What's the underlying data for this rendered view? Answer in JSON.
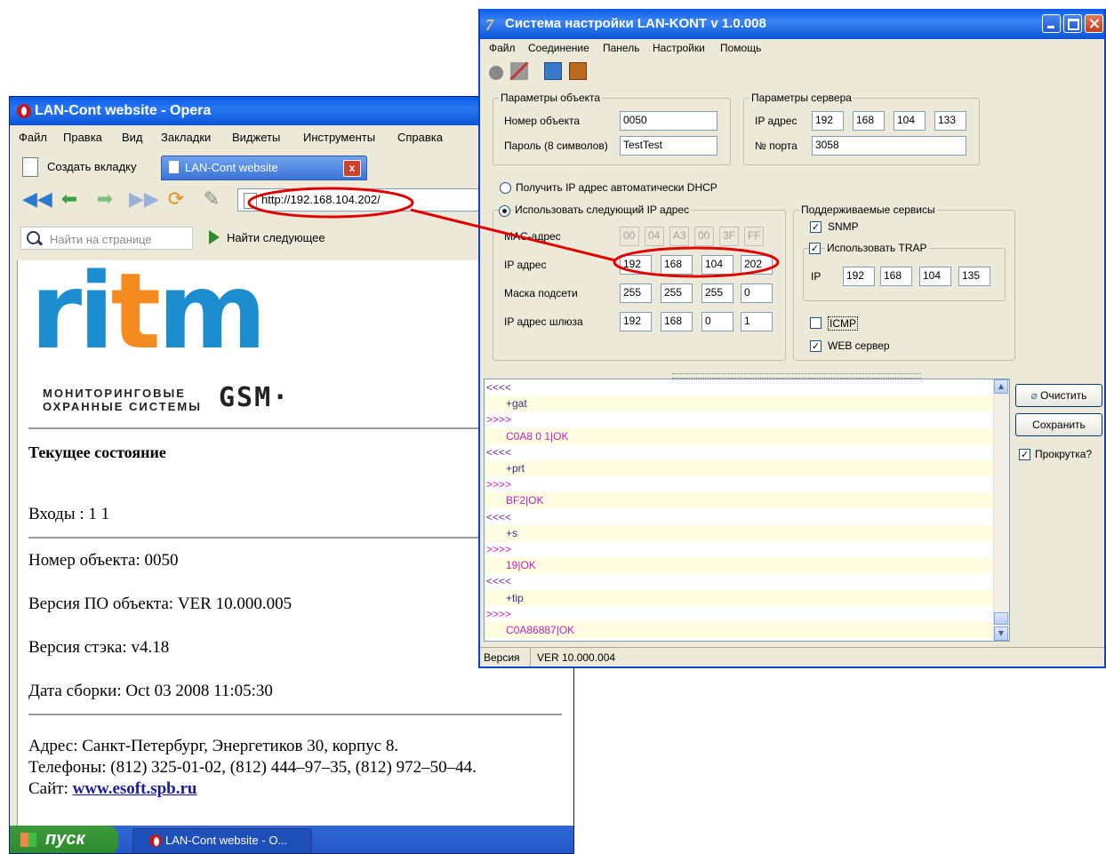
{
  "opera": {
    "title": "LAN-Cont website - Opera",
    "menu": [
      "Файл",
      "Правка",
      "Вид",
      "Закладки",
      "Виджеты",
      "Инструменты",
      "Справка"
    ],
    "new_tab_label": "Создать вкладку",
    "active_tab": "LAN-Cont website",
    "address": "http://192.168.104.202/",
    "find_placeholder": "Найти на странице",
    "find_next": "Найти следующее",
    "logo": {
      "brand_part1": "ri",
      "brand_part2": "t",
      "brand_part3": "m",
      "subtitle_line1": "МОНИТОРИНГОВЫЕ",
      "subtitle_line2": "ОХРАННЫЕ СИСТЕМЫ",
      "gsm": "GSM·"
    },
    "page": {
      "heading": "Текущее состояние",
      "inputs": "Входы : 1 1",
      "object_number": "Номер объекта: 0050",
      "firmware": "Версия ПО объекта: VER 10.000.005",
      "stack": "Версия стэка: v4.18",
      "build_date": "Дата сборки: Oct 03 2008 11:05:30",
      "address": "Адрес: Санкт-Петербург, Энергетиков 30, корпус 8.",
      "phones": "Телефоны: (812) 325-01-02, (812) 444–97–35, (812) 972–50–44.",
      "site_label": "Сайт:",
      "site_link": "www.esoft.spb.ru"
    },
    "taskbar": {
      "start": "пуск",
      "item": "LAN-Cont website - O..."
    }
  },
  "lan": {
    "title": "Система настройки LAN-KONT v 1.0.008",
    "menu": [
      "Файл",
      "Соединение",
      "Панель",
      "Настройки",
      "Помощь"
    ],
    "object_params": {
      "title": "Параметры объекта",
      "number_label": "Номер объекта",
      "number_value": "0050",
      "password_label": "Пароль (8 символов)",
      "password_value": "TestTest"
    },
    "server_params": {
      "title": "Параметры сервера",
      "ip_label": "IP адрес",
      "ip": [
        "192",
        "168",
        "104",
        "133"
      ],
      "port_label": "№ порта",
      "port_value": "3058"
    },
    "dhcp_radio": "Получить IP адрес автоматически DHCP",
    "static": {
      "title": "Использовать следующий IP адрес",
      "mac_label": "MAC-адрес",
      "mac": [
        "00",
        "04",
        "A3",
        "00",
        "3F",
        "FF"
      ],
      "ip_label": "IP адрес",
      "ip": [
        "192",
        "168",
        "104",
        "202"
      ],
      "mask_label": "Маска подсети",
      "mask": [
        "255",
        "255",
        "255",
        "0"
      ],
      "gateway_label": "IP адрес шлюза",
      "gateway": [
        "192",
        "168",
        "0",
        "1"
      ]
    },
    "services": {
      "title": "Поддерживаемые сервисы",
      "snmp": "SNMP",
      "trap": "Использовать TRAP",
      "trap_ip_label": "IP",
      "trap_ip": [
        "192",
        "168",
        "104",
        "135"
      ],
      "icmp": "ICMP",
      "web": "WEB сервер",
      "check_mark": "✓"
    },
    "log": [
      {
        "text": "<<<<",
        "color": "#6a2aa0"
      },
      {
        "text": "+gat",
        "color": "#3a2a8a"
      },
      {
        "text": ">>>>",
        "color": "#c020c0"
      },
      {
        "text": "C0A8 0 1|OK",
        "color": "#c020c0"
      },
      {
        "text": "<<<<",
        "color": "#6a2aa0"
      },
      {
        "text": "+prt",
        "color": "#3a2a8a"
      },
      {
        "text": ">>>>",
        "color": "#c020c0"
      },
      {
        "text": "BF2|OK",
        "color": "#c020c0"
      },
      {
        "text": "<<<<",
        "color": "#6a2aa0"
      },
      {
        "text": "+s",
        "color": "#3a2a8a"
      },
      {
        "text": ">>>>",
        "color": "#c020c0"
      },
      {
        "text": "19|OK",
        "color": "#c020c0"
      },
      {
        "text": "<<<<",
        "color": "#6a2aa0"
      },
      {
        "text": "+tip",
        "color": "#3a2a8a"
      },
      {
        "text": ">>>>",
        "color": "#c020c0"
      },
      {
        "text": "C0A86887|OK",
        "color": "#c020c0"
      }
    ],
    "buttons": {
      "clear": "Очистить",
      "save": "Сохранить",
      "scroll": "Прокрутка?"
    },
    "status": {
      "label": "Версия",
      "value": "VER 10.000.004"
    }
  },
  "colors": {
    "annotation": "#e00000",
    "xp_title_blue": "#0a5ae8",
    "ritm_blue": "#1c8ed0",
    "ritm_orange": "#f58a1f"
  }
}
